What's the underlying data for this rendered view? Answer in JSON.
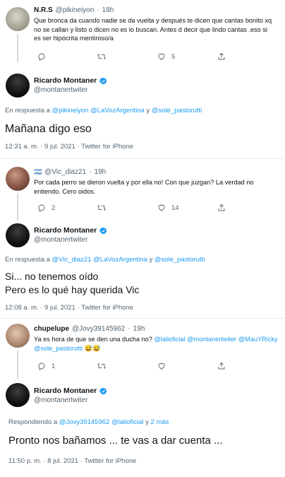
{
  "tweet1": {
    "name": "N.R.S",
    "handle": "@pikineiyon",
    "sep": "·",
    "time": "18h",
    "text": "Que bronca da cuando nadie se da vuelta y después te dicen que cantas bonito xq no se callan y listo o dicen no es lo buscan.  Antes d decir que lindo cantas .eso si es ser hipócrita mentiroso/a",
    "likes": "5"
  },
  "main1": {
    "name": "Ricardo Montaner",
    "handle": "@montanertwiter",
    "reply_prefix": "En respuesta a",
    "reply_links": [
      "@pikineiyon",
      "@LaVozArgentina"
    ],
    "reply_and": "y",
    "reply_last": "@sole_pastorutti",
    "text": "Mañana digo eso",
    "meta": "12:31 a. m. · 9 jul. 2021 · Twitter for iPhone"
  },
  "tweet2": {
    "flag": "🇦🇷",
    "handle": "@Vic_diaz21",
    "sep": "·",
    "time": "19h",
    "text": "Por cada perro se dieron vuelta y por ella no! Con que juzgan? La verdad no entiendo. Cero oidos.",
    "replies": "2",
    "likes": "14"
  },
  "main2": {
    "name": "Ricardo Montaner",
    "handle": "@montanertwiter",
    "reply_prefix": "En respuesta a",
    "reply_links": [
      "@Vic_diaz21",
      "@LaVozArgentina"
    ],
    "reply_and": "y",
    "reply_last": "@sole_pastorutti",
    "text_line1": "Si... no tenemos oído",
    "text_line2": "Pero es lo qué hay querida Vic",
    "meta": "12:08 a. m. · 9 jul. 2021 · Twitter for iPhone"
  },
  "tweet3": {
    "name": "chupelupe",
    "handle": "@Jovy39145962",
    "sep": "·",
    "time": "19h",
    "text_plain": "Ya es hora de que se den una ducha no?",
    "mention1": "@lalioficial",
    "mention2": "@montanertwiter",
    "mention3": "@MauYRicky",
    "mention4": "@sole_pastorutti",
    "emoji": "😅😅",
    "replies": "1"
  },
  "main3": {
    "name": "Ricardo Montaner",
    "handle": "@montanertwiter",
    "reply_prefix": "Respondiendo a",
    "reply_links": [
      "@Jovy39145962",
      "@lalioficial"
    ],
    "reply_and": "y",
    "reply_last": "2 más",
    "text": "Pronto nos bañamos ... te vas a dar cuenta ...",
    "meta": "11:50 p. m. · 8 jul. 2021 · Twitter for iPhone"
  },
  "colors": {
    "accent": "#1d9bf0",
    "muted": "#536471",
    "verified": "#1d9bf0"
  }
}
